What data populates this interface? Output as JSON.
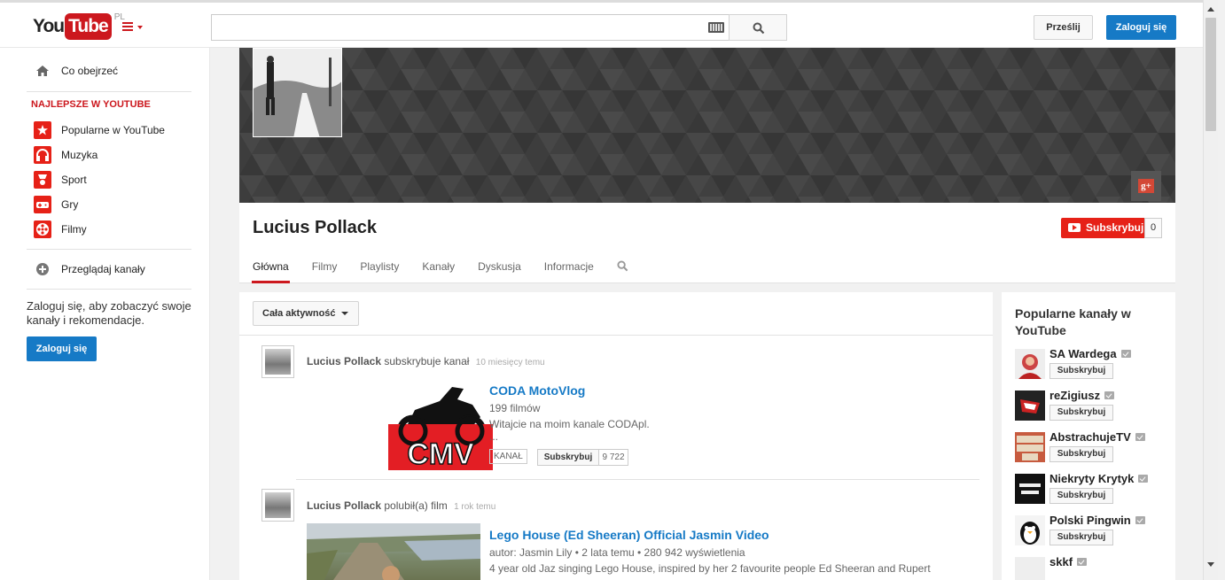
{
  "masthead": {
    "logo_you": "You",
    "logo_tube": "Tube",
    "logo_region": "PL",
    "search_placeholder": "",
    "upload_label": "Prześlij",
    "login_label": "Zaloguj się"
  },
  "guide": {
    "items_top": [
      {
        "label": "Co obejrzeć",
        "icon": "home-icon"
      }
    ],
    "heading": "NAJLEPSZE W YOUTUBE",
    "best_items": [
      {
        "label": "Popularne w YouTube",
        "icon": "star-icon"
      },
      {
        "label": "Muzyka",
        "icon": "headphones-icon"
      },
      {
        "label": "Sport",
        "icon": "trophy-icon"
      },
      {
        "label": "Gry",
        "icon": "gamepad-icon"
      },
      {
        "label": "Filmy",
        "icon": "film-reel-icon"
      }
    ],
    "browse_label": "Przeglądaj kanały",
    "signin_text": "Zaloguj się, aby zobaczyć swoje kanały i rekomendacje.",
    "signin_button": "Zaloguj się"
  },
  "channel": {
    "title": "Lucius Pollack",
    "subscribe_label": "Subskrybuj",
    "subscriber_count": "0",
    "tabs": [
      "Główna",
      "Filmy",
      "Playlisty",
      "Kanały",
      "Dyskusja",
      "Informacje"
    ],
    "active_tab": "Główna"
  },
  "feed": {
    "filter_label": "Cała aktywność",
    "items": [
      {
        "author": "Lucius Pollack",
        "action": "subskrybuje kanał",
        "time": "10 miesięcy temu",
        "title": "CODA MotoVlog",
        "meta1": "199 filmów",
        "meta2": "Witajcie na moim kanale CODApl.",
        "meta3": "...",
        "badge": "KANAŁ",
        "subscribe_label": "Subskrybuj",
        "subscriber_count": "9 722",
        "logo_text": "CMV"
      },
      {
        "author": "Lucius Pollack",
        "action": "polubił(a) film",
        "time": "1 rok temu",
        "title": "Lego House (Ed Sheeran) Official Jasmin Video",
        "meta1": "autor: Jasmin Lily",
        "meta1b": "2 lata temu",
        "meta1c": "280 942 wyświetlenia",
        "meta2": "4 year old Jaz singing Lego House, inspired by her 2 favourite people Ed Sheeran and Rupert"
      }
    ]
  },
  "rail": {
    "title": "Popularne kanały w YouTube",
    "subscribe_label": "Subskrybuj",
    "channels": [
      {
        "name": "SA Wardega"
      },
      {
        "name": "reZigiusz"
      },
      {
        "name": "AbstrachujeTV"
      },
      {
        "name": "Niekryty Krytyk"
      },
      {
        "name": "Polski Pingwin"
      },
      {
        "name": "skkf"
      }
    ]
  },
  "colors": {
    "brand_red": "#cc181e",
    "link_blue": "#167ac6",
    "subscribe_red": "#e62117"
  }
}
